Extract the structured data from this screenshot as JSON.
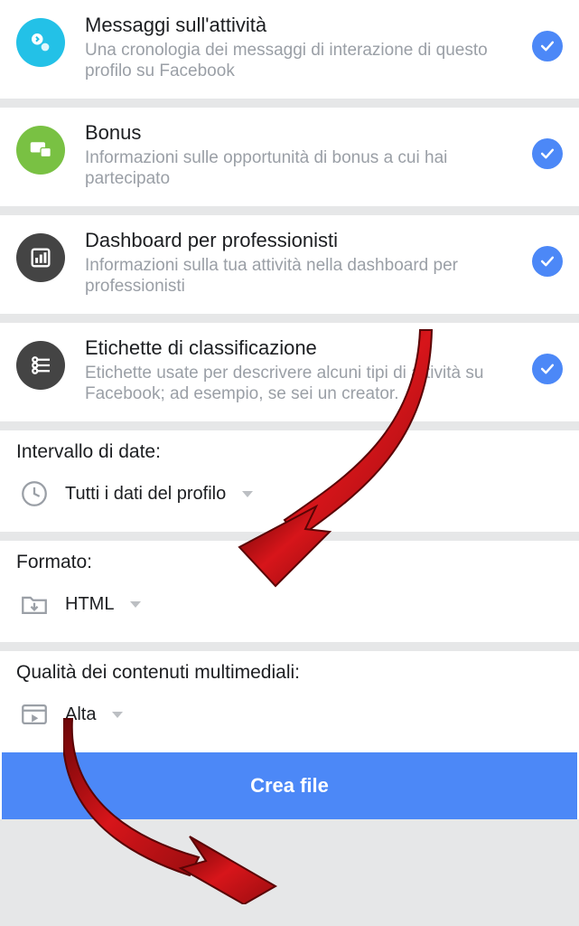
{
  "items": [
    {
      "title": "Messaggi sull'attività",
      "desc": "Una cronologia dei messaggi di interazione di questo profilo su Facebook",
      "chip_bg": "#23c1e7",
      "icon": "activity"
    },
    {
      "title": "Bonus",
      "desc": "Informazioni sulle opportunità di bonus a cui hai partecipato",
      "chip_bg": "#79c143",
      "icon": "devices"
    },
    {
      "title": "Dashboard per professionisti",
      "desc": "Informazioni sulla tua attività nella dashboard per professionisti",
      "chip_bg": "#444444",
      "icon": "dashboard"
    },
    {
      "title": "Etichette di classificazione",
      "desc": "Etichette usate per descrivere alcuni tipi di attività su Facebook; ad esempio, se sei un creator.",
      "chip_bg": "#444444",
      "icon": "labels"
    }
  ],
  "date_range": {
    "label": "Intervallo di date:",
    "value": "Tutti i dati del profilo"
  },
  "format": {
    "label": "Formato:",
    "value": "HTML"
  },
  "quality": {
    "label": "Qualità dei contenuti multimediali:",
    "value": "Alta"
  },
  "cta": "Crea file"
}
